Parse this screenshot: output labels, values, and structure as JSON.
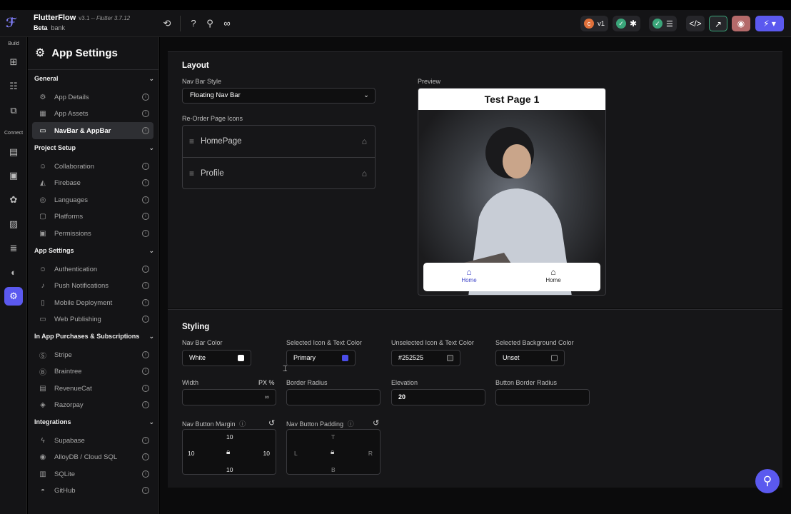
{
  "header": {
    "app_name": "FlutterFlow",
    "version": "v3.1",
    "flutter": "-- Flutter 3.7.12",
    "channel": "Beta",
    "project": "bank",
    "version_pill": "v1"
  },
  "rail": {
    "build_label": "Build",
    "connect_label": "Connect"
  },
  "sidebar": {
    "title": "App Settings",
    "sections": [
      {
        "label": "General",
        "items": [
          "App Details",
          "App Assets",
          "NavBar & AppBar"
        ]
      },
      {
        "label": "Project Setup",
        "items": [
          "Collaboration",
          "Firebase",
          "Languages",
          "Platforms",
          "Permissions"
        ]
      },
      {
        "label": "App Settings",
        "items": [
          "Authentication",
          "Push Notifications",
          "Mobile Deployment",
          "Web Publishing"
        ]
      },
      {
        "label": "In App Purchases & Subscriptions",
        "items": [
          "Stripe",
          "Braintree",
          "RevenueCat",
          "Razorpay"
        ]
      },
      {
        "label": "Integrations",
        "items": [
          "Supabase",
          "AlloyDB / Cloud SQL",
          "SQLite",
          "GitHub"
        ]
      }
    ]
  },
  "layout": {
    "title": "Layout",
    "nav_bar_style_label": "Nav Bar Style",
    "nav_bar_style_value": "Floating Nav Bar",
    "reorder_label": "Re-Order Page Icons",
    "pages": [
      "HomePage",
      "Profile"
    ],
    "preview_label": "Preview",
    "preview_title": "Test Page 1",
    "preview_nav": [
      "Home",
      "Home"
    ]
  },
  "styling": {
    "title": "Styling",
    "nav_bar_color_label": "Nav Bar Color",
    "nav_bar_color_value": "White",
    "selected_icon_label": "Selected Icon & Text Color",
    "selected_icon_value": "Primary",
    "unselected_icon_label": "Unselected Icon & Text Color",
    "unselected_icon_value": "#252525",
    "selected_bg_label": "Selected Background Color",
    "selected_bg_value": "Unset",
    "width_label": "Width",
    "width_units": "PX  %",
    "width_value": "∞",
    "border_radius_label": "Border Radius",
    "elevation_label": "Elevation",
    "elevation_value": "20",
    "button_border_radius_label": "Button Border Radius",
    "margin_label": "Nav Button Margin",
    "margin": {
      "top": "10",
      "left": "10",
      "right": "10",
      "bottom": "10"
    },
    "padding_label": "Nav Button Padding",
    "padding": {
      "top": "T",
      "left": "L",
      "right": "R",
      "bottom": "B"
    }
  },
  "colors": {
    "accent": "#5b59ef",
    "primary_swatch": "#4b4de8"
  }
}
